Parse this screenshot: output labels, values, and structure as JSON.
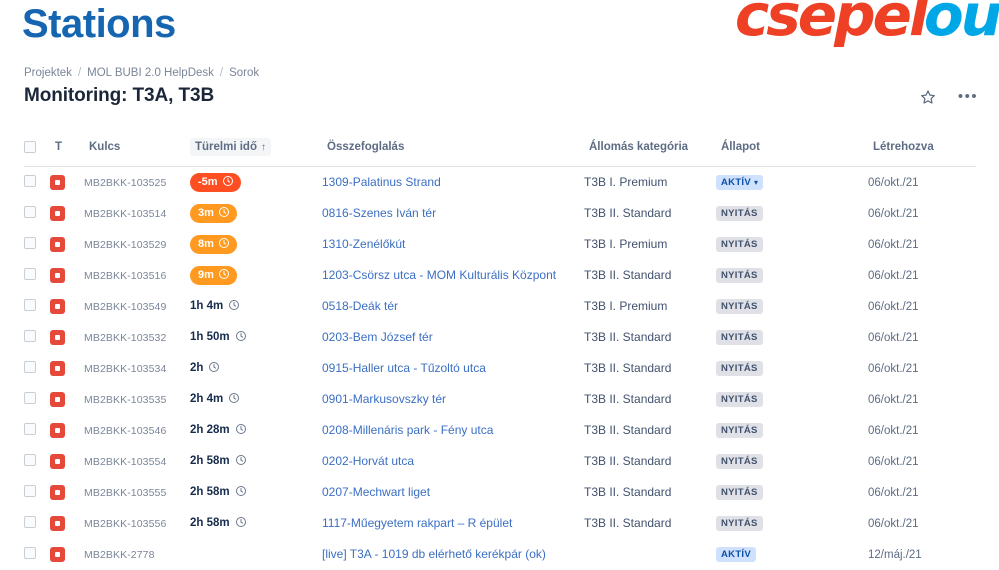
{
  "banner": {
    "title": "Stations",
    "logo_red": "csepel",
    "logo_blue": "ou",
    "logo_red_color": "#ee4024",
    "logo_blue_color": "#00a7e7",
    "title_color": "#1565b0"
  },
  "breadcrumb": {
    "items": [
      "Projektek",
      "MOL BUBI 2.0 HelpDesk",
      "Sorok"
    ],
    "separator": "/"
  },
  "header": {
    "page_title": "Monitoring: T3A, T3B",
    "star_icon": "star-icon",
    "more_icon": "more-actions-icon"
  },
  "table": {
    "columns": [
      {
        "key": "checkbox",
        "label": ""
      },
      {
        "key": "type",
        "label": "T"
      },
      {
        "key": "key",
        "label": "Kulcs"
      },
      {
        "key": "sla",
        "label": "Türelmi idő",
        "sorted": true,
        "sort_arrow": "↑"
      },
      {
        "key": "summary",
        "label": "Összefoglalás"
      },
      {
        "key": "category",
        "label": "Állomás kategória"
      },
      {
        "key": "status",
        "label": "Állapot"
      },
      {
        "key": "created",
        "label": "Létrehozva"
      }
    ],
    "rows": [
      {
        "type_icon": "bug-icon",
        "key": "MB2BKK-103525",
        "sla": "-5m",
        "sla_style": "pill-red",
        "summary": "1309-Palatinus Strand",
        "category": "T3B I. Premium",
        "status": "AKTÍV",
        "status_style": "lozenge-blue-dropdown",
        "created": "06/okt./21"
      },
      {
        "type_icon": "bug-icon",
        "key": "MB2BKK-103514",
        "sla": "3m",
        "sla_style": "pill-orange",
        "summary": "0816-Szenes Iván tér",
        "category": "T3B II. Standard",
        "status": "NYITÁS",
        "status_style": "lozenge-grey",
        "created": "06/okt./21"
      },
      {
        "type_icon": "bug-icon",
        "key": "MB2BKK-103529",
        "sla": "8m",
        "sla_style": "pill-orange",
        "summary": "1310-Zenélőkút",
        "category": "T3B I. Premium",
        "status": "NYITÁS",
        "status_style": "lozenge-grey",
        "created": "06/okt./21"
      },
      {
        "type_icon": "bug-icon",
        "key": "MB2BKK-103516",
        "sla": "9m",
        "sla_style": "pill-orange",
        "summary": "1203-Csörsz utca - MOM Kulturális Központ",
        "category": "T3B II. Standard",
        "status": "NYITÁS",
        "status_style": "lozenge-grey",
        "created": "06/okt./21"
      },
      {
        "type_icon": "bug-icon",
        "key": "MB2BKK-103549",
        "sla": "1h 4m",
        "sla_style": "plain",
        "summary": "0518-Deák tér",
        "category": "T3B I. Premium",
        "status": "NYITÁS",
        "status_style": "lozenge-grey",
        "created": "06/okt./21"
      },
      {
        "type_icon": "bug-icon",
        "key": "MB2BKK-103532",
        "sla": "1h 50m",
        "sla_style": "plain",
        "summary": "0203-Bem József tér",
        "category": "T3B II. Standard",
        "status": "NYITÁS",
        "status_style": "lozenge-grey",
        "created": "06/okt./21"
      },
      {
        "type_icon": "bug-icon",
        "key": "MB2BKK-103534",
        "sla": "2h",
        "sla_style": "plain",
        "summary": "0915-Haller utca - Tűzoltó utca",
        "category": "T3B II. Standard",
        "status": "NYITÁS",
        "status_style": "lozenge-grey",
        "created": "06/okt./21"
      },
      {
        "type_icon": "bug-icon",
        "key": "MB2BKK-103535",
        "sla": "2h 4m",
        "sla_style": "plain",
        "summary": "0901-Markusovszky tér",
        "category": "T3B II. Standard",
        "status": "NYITÁS",
        "status_style": "lozenge-grey",
        "created": "06/okt./21"
      },
      {
        "type_icon": "bug-icon",
        "key": "MB2BKK-103546",
        "sla": "2h 28m",
        "sla_style": "plain",
        "summary": "0208-Millenáris park - Fény utca",
        "category": "T3B II. Standard",
        "status": "NYITÁS",
        "status_style": "lozenge-grey",
        "created": "06/okt./21"
      },
      {
        "type_icon": "bug-icon",
        "key": "MB2BKK-103554",
        "sla": "2h 58m",
        "sla_style": "plain",
        "summary": "0202-Horvát utca",
        "category": "T3B II. Standard",
        "status": "NYITÁS",
        "status_style": "lozenge-grey",
        "created": "06/okt./21"
      },
      {
        "type_icon": "bug-icon",
        "key": "MB2BKK-103555",
        "sla": "2h 58m",
        "sla_style": "plain",
        "summary": "0207-Mechwart liget",
        "category": "T3B II. Standard",
        "status": "NYITÁS",
        "status_style": "lozenge-grey",
        "created": "06/okt./21"
      },
      {
        "type_icon": "bug-icon",
        "key": "MB2BKK-103556",
        "sla": "2h 58m",
        "sla_style": "plain",
        "summary": "1117-Műegyetem rakpart – R épület",
        "category": "T3B II. Standard",
        "status": "NYITÁS",
        "status_style": "lozenge-grey",
        "created": "06/okt./21"
      },
      {
        "type_icon": "bug-icon",
        "key": "MB2BKK-2778",
        "sla": "",
        "sla_style": "none",
        "summary": "[live] T3A - 1019 db elérhető kerékpár (ok)",
        "category": "",
        "status": "AKTÍV",
        "status_style": "lozenge-blue",
        "created": "12/máj./21"
      }
    ]
  },
  "colors": {
    "sla_breached": "#ff4e21",
    "sla_warning": "#ff991f",
    "link": "#3b6fc4",
    "status_active_bg": "#cfe1fd",
    "status_open_bg": "#dfe1e6"
  }
}
